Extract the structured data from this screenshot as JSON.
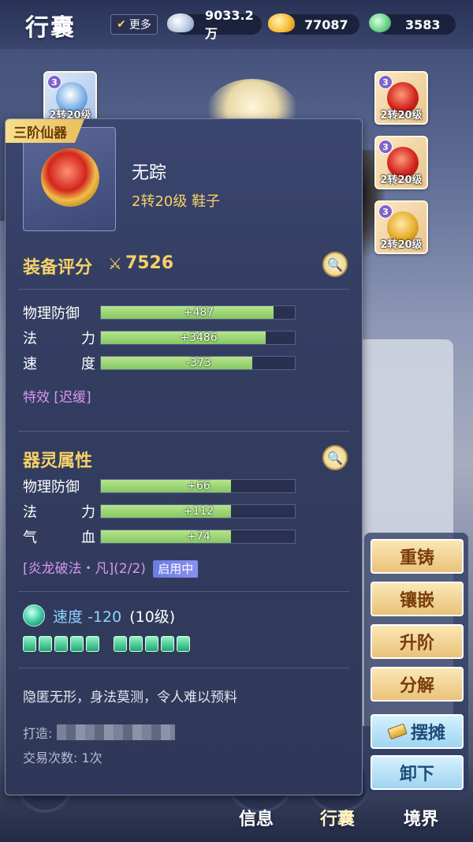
{
  "header": {
    "title": "行囊",
    "more_label": "更多",
    "currencies": [
      {
        "name": "silver",
        "value": "9033.2万"
      },
      {
        "name": "gold",
        "value": "77087"
      },
      {
        "name": "jade",
        "value": "3583"
      }
    ]
  },
  "equipment_slots": [
    {
      "stars": "3",
      "level": "2转20级",
      "icon": "robe-icon"
    },
    {
      "stars": "3",
      "level": "2转20级",
      "icon": "necklace-icon"
    },
    {
      "stars": "3",
      "level": "2转20级",
      "icon": "armor-icon"
    },
    {
      "stars": "3",
      "level": "2转20级",
      "icon": "boots-icon"
    }
  ],
  "tooltip": {
    "grade_tag": "三阶仙器",
    "item_name": "无踪",
    "item_level": "2转20级 鞋子",
    "score_label": "装备评分",
    "score_value": "7526",
    "base_stats": [
      {
        "name_a": "物理防御",
        "name_b": "",
        "value": "+487",
        "fill": 0.89
      },
      {
        "name_a": "法",
        "name_b": "力",
        "value": "+3486",
        "fill": 0.85
      },
      {
        "name_a": "速",
        "name_b": "度",
        "value": "-373",
        "fill": 0.78
      }
    ],
    "special_effect": "特效 [迟缓]",
    "spirit_label": "器灵属性",
    "spirit_stats": [
      {
        "name_a": "物理防御",
        "name_b": "",
        "value": "+66",
        "fill": 0.67
      },
      {
        "name_a": "法",
        "name_b": "力",
        "value": "+112",
        "fill": 0.67
      },
      {
        "name_a": "气",
        "name_b": "血",
        "value": "+74",
        "fill": 0.67
      }
    ],
    "set_effect": "[炎龙破法・凡](2/2)",
    "set_status": "启用中",
    "gem_label": "速度",
    "gem_value": "-120",
    "gem_level": "(10级)",
    "gem_pips": 10,
    "description": "隐匿无形，身法莫测，令人难以预料",
    "maker_label": "打造:",
    "trade_count": "交易次数: 1次"
  },
  "actions": {
    "recast": "重铸",
    "inlay": "镶嵌",
    "upgrade": "升阶",
    "decompose": "分解",
    "stall": "摆摊",
    "unequip": "卸下"
  },
  "bottom_nav": {
    "info": "信息",
    "bag": "行囊",
    "realm": "境界"
  },
  "colors": {
    "accent_gold": "#f6d168",
    "stat_bar": "#86c763",
    "effect_purple": "#d996f2"
  }
}
